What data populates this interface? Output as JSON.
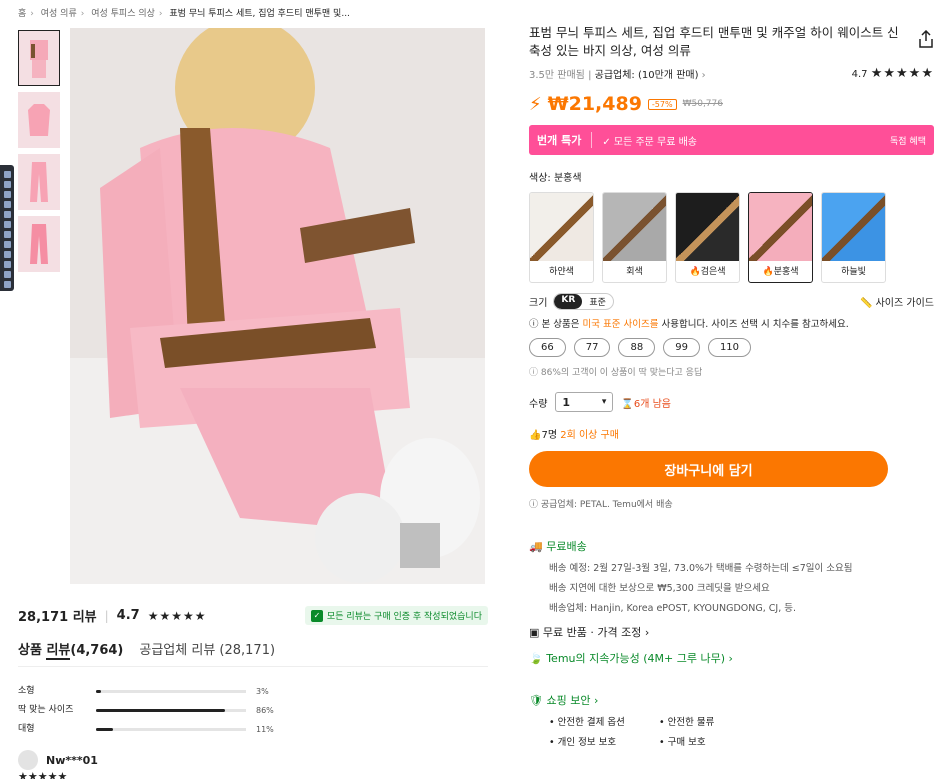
{
  "breadcrumb": [
    "홈",
    "여성 의류",
    "여성 투피스 의상",
    "표범 무늬 투피스 세트, 집업 후드티 맨투맨 및..."
  ],
  "product": {
    "title": "표범 무늬 투피스 세트, 집업 후드티 맨투맨 및 캐주얼 하이 웨이스트 신축성 있는 바지 의상, 여성 의류",
    "sold": "3.5만 판매됨",
    "supplier_label": "공급업체:",
    "supplier_sales": "(10만개 판매)",
    "rating": "4.7",
    "stars": "★★★★★",
    "price": "₩21,489",
    "discount": "-57%",
    "original_price": "₩50,776"
  },
  "promo": {
    "left": "번개 특가",
    "mid": "✓ 모든 주문 무료 배송",
    "right": "독점 혜택"
  },
  "color": {
    "label": "색상: 분홍색",
    "options": [
      {
        "name": "하얀색",
        "hot": false
      },
      {
        "name": "회색",
        "hot": false
      },
      {
        "name": "검은색",
        "hot": true
      },
      {
        "name": "분홍색",
        "hot": true
      },
      {
        "name": "하늘빛",
        "hot": false
      }
    ]
  },
  "size": {
    "label": "크기",
    "toggle_on": "KR",
    "toggle_off": "표준",
    "guide": "사이즈 가이드",
    "note_pre": "ⓘ 본 상품은 ",
    "note_hl": "미국 표준 사이즈를",
    "note_post": " 사용합니다. 사이즈 선택 시 치수를 참고하세요.",
    "options": [
      "66",
      "77",
      "88",
      "99",
      "110"
    ],
    "fit_note": "ⓘ 86%의 고객이 이 상품이 딱 맞는다고 응답"
  },
  "quantity": {
    "label": "수량",
    "value": "1",
    "stock": "6개 남음"
  },
  "buyers": {
    "pre": "7명 ",
    "hl": "2회 이상 구매"
  },
  "cart_button": "장바구니에 담기",
  "supplier_note": "ⓘ 공급업체: PETAL. Temu에서 배송",
  "shipping": {
    "title": "무료배송",
    "line1": "배송 예정: 2월 27일-3월 3일, 73.0%가 택배를 수령하는데 ≤7일이 소요됨",
    "line2": "배송 지연에 대한 보상으로 ₩5,300 크레딧을 받으세요",
    "line3": "배송업체: Hanjin, Korea ePOST, KYOUNGDONG, CJ, 등."
  },
  "returns": "무료 반품 · 가격 조정 ›",
  "sustainability": "Temu의 지속가능성 (4M+ 그루 나무) ›",
  "safety": {
    "title": "쇼핑 보안 ›",
    "items": [
      "• 안전한 결제 옵션",
      "• 안전한 물류",
      "• 개인 정보 보호",
      "• 구매 보호"
    ]
  },
  "reviews": {
    "count": "28,171 리뷰",
    "rating": "4.7",
    "stars": "★★★★★",
    "verified": "모든 리뷰는 구매 인증 후 작성되었습니다",
    "tab_product_a": "상품 ",
    "tab_product_b": "리뷰",
    "tab_product_c": "(4,764)",
    "tab_supplier": "공급업체 리뷰 (28,171)",
    "fit": [
      {
        "label": "소형",
        "percent": 3,
        "pct_text": "3%"
      },
      {
        "label": "딱 맞는 사이즈",
        "percent": 86,
        "pct_text": "86%"
      },
      {
        "label": "대형",
        "percent": 11,
        "pct_text": "11%"
      }
    ],
    "reviewer_name": "Nw***01",
    "reviewer_stars": "★★★★★"
  }
}
